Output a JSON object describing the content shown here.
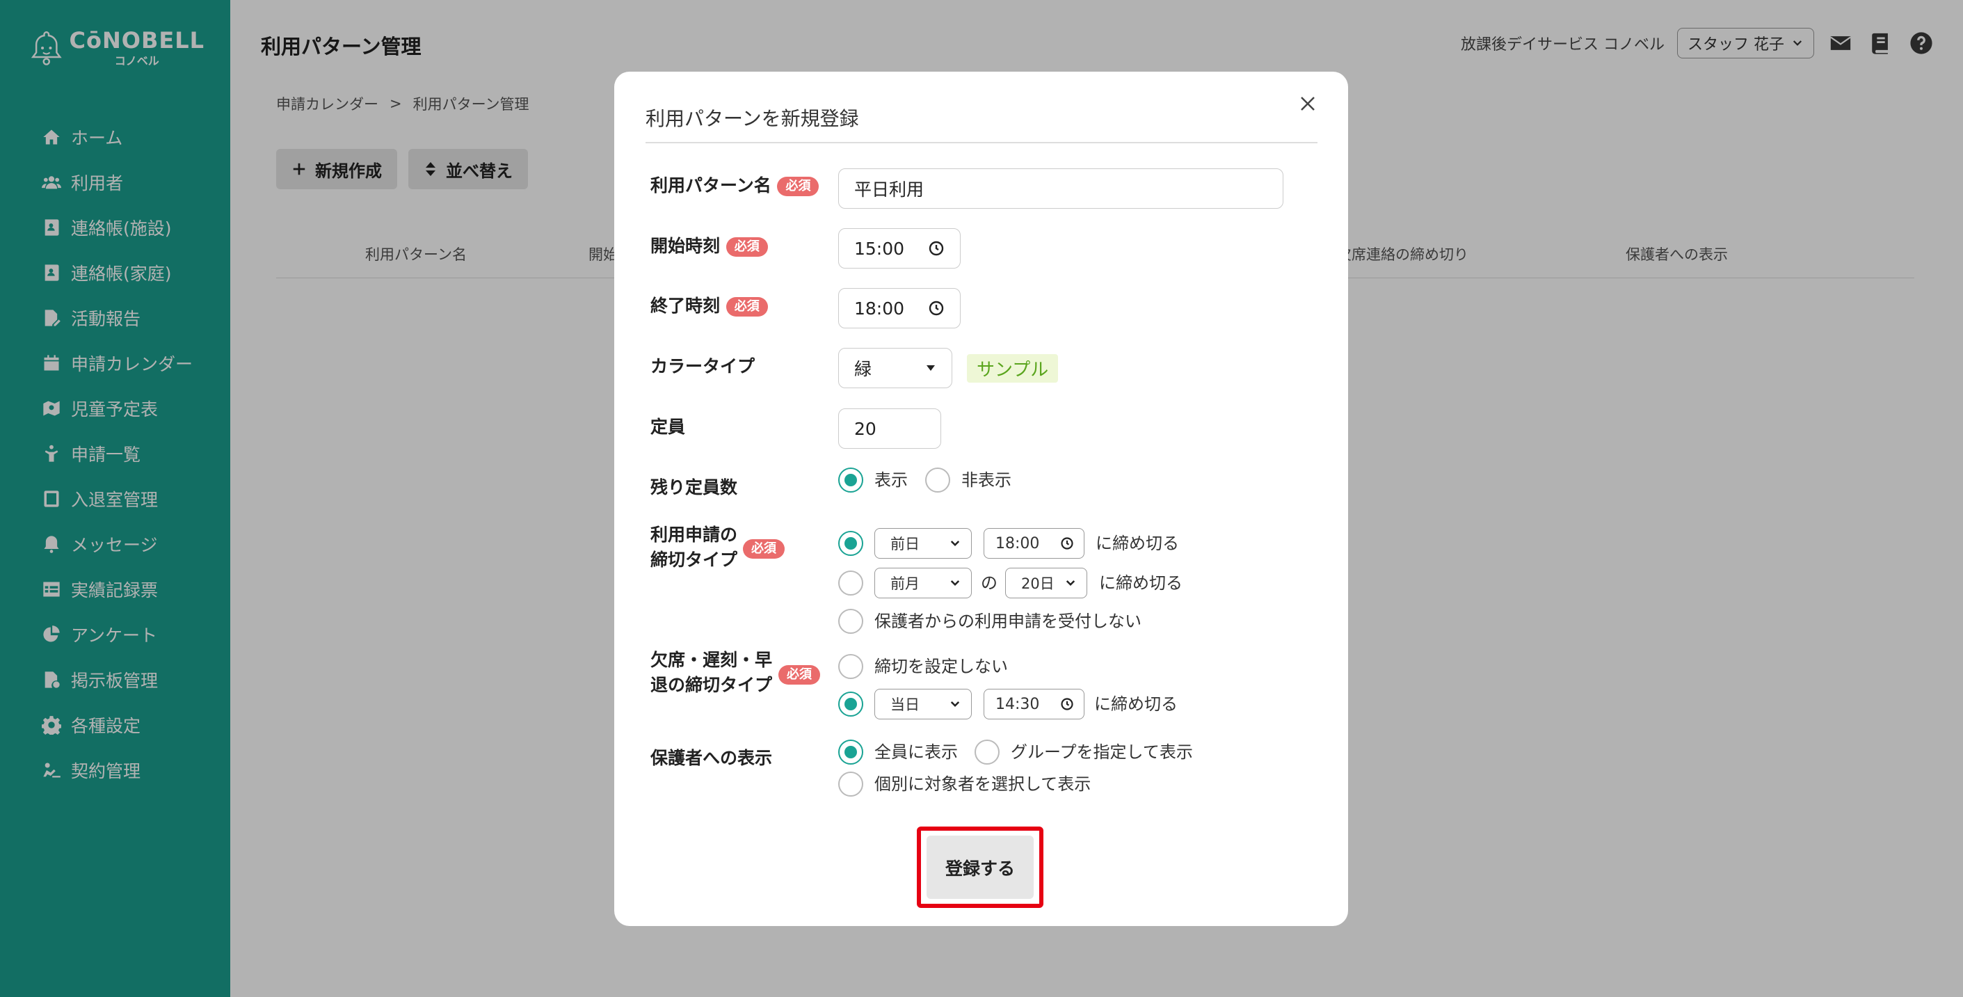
{
  "app": {
    "logo_main": "CōNOBELL",
    "logo_sub": "コノベル"
  },
  "sidebar": {
    "items": [
      {
        "label": "ホーム",
        "icon": "home-icon"
      },
      {
        "label": "利用者",
        "icon": "users-icon"
      },
      {
        "label": "連絡帳(施設)",
        "icon": "contact-book-icon"
      },
      {
        "label": "連絡帳(家庭)",
        "icon": "contact-book-icon"
      },
      {
        "label": "活動報告",
        "icon": "report-icon"
      },
      {
        "label": "申請カレンダー",
        "icon": "calendar-icon"
      },
      {
        "label": "児童予定表",
        "icon": "schedule-icon"
      },
      {
        "label": "申請一覧",
        "icon": "child-icon"
      },
      {
        "label": "入退室管理",
        "icon": "tablet-icon"
      },
      {
        "label": "メッセージ",
        "icon": "bell-icon"
      },
      {
        "label": "実績記録票",
        "icon": "table-icon"
      },
      {
        "label": "アンケート",
        "icon": "pie-chart-icon"
      },
      {
        "label": "掲示板管理",
        "icon": "board-icon"
      },
      {
        "label": "各種設定",
        "icon": "gear-icon"
      },
      {
        "label": "契約管理",
        "icon": "contract-icon"
      }
    ]
  },
  "header": {
    "title": "利用パターン管理",
    "facility": "放課後デイサービス コノベル",
    "staff": "スタッフ 花子"
  },
  "breadcrumb": {
    "parent": "申請カレンダー",
    "separator": ">",
    "current": "利用パターン管理"
  },
  "toolbar": {
    "new_label": "新規作成",
    "sort_label": "並べ替え"
  },
  "table": {
    "columns": [
      "利用パターン名",
      "開始",
      "欠席連絡の締め切り",
      "保護者への表示"
    ]
  },
  "modal": {
    "title": "利用パターンを新規登録",
    "required_badge": "必須",
    "name": {
      "label": "利用パターン名",
      "value": "平日利用"
    },
    "start_time": {
      "label": "開始時刻",
      "value": "15:00"
    },
    "end_time": {
      "label": "終了時刻",
      "value": "18:00"
    },
    "color": {
      "label": "カラータイプ",
      "value": "緑",
      "sample": "サンプル",
      "sample_color": "#5aa51d"
    },
    "capacity": {
      "label": "定員",
      "value": "20"
    },
    "remaining": {
      "label": "残り定員数",
      "options": [
        "表示",
        "非表示"
      ],
      "selected": "表示"
    },
    "apply_deadline": {
      "label_line1": "利用申請の",
      "label_line2": "締切タイプ",
      "opt1_day": "前日",
      "opt1_time": "18:00",
      "opt1_suffix": "に締め切る",
      "opt2_month": "前月",
      "opt2_no": "の",
      "opt2_date": "20日",
      "opt2_suffix": "に締め切る",
      "opt3_text": "保護者からの利用申請を受付しない",
      "selected": 1
    },
    "absence_deadline": {
      "label_line1": "欠席・遅刻・早",
      "label_line2": "退の締切タイプ",
      "opt1_text": "締切を設定しない",
      "opt2_day": "当日",
      "opt2_time": "14:30",
      "opt2_suffix": "に締め切る",
      "selected": 2
    },
    "guardian_display": {
      "label": "保護者への表示",
      "opt1": "全員に表示",
      "opt2": "グループを指定して表示",
      "opt3": "個別に対象者を選択して表示",
      "selected": 1
    },
    "submit_label": "登録する"
  },
  "colors": {
    "accent": "#1aa394",
    "required": "#ea6b6b",
    "highlight": "#e60012"
  }
}
